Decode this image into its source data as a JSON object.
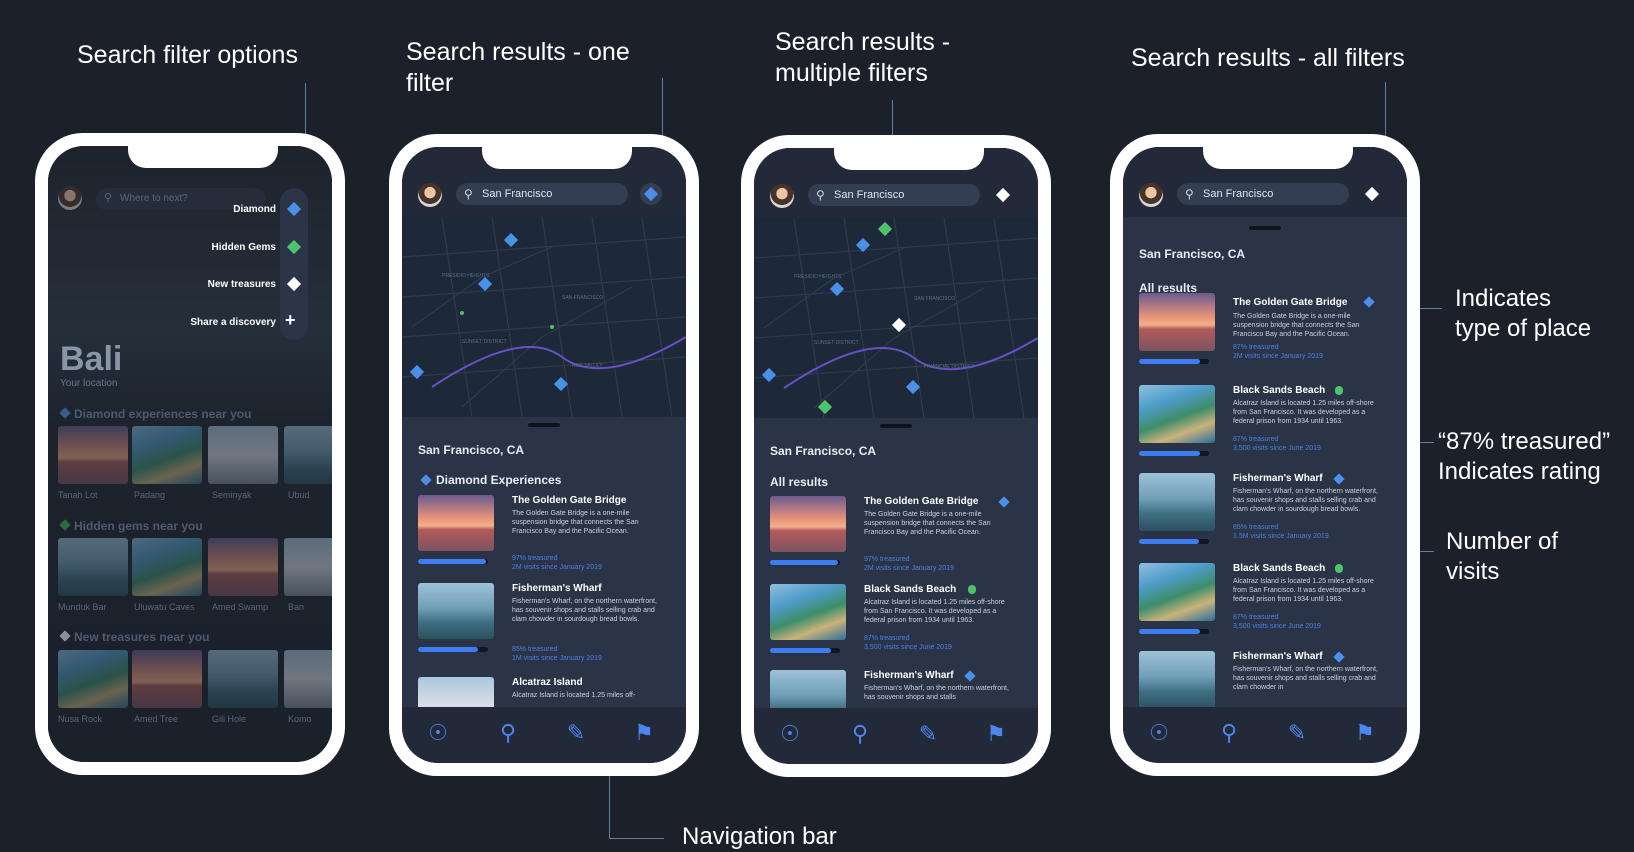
{
  "annotations": {
    "filter_options": "Search filter options",
    "one_filter": "Search results - one\nfilter",
    "multiple_filters": "Search results -\nmultiple filters",
    "all_filters": "Search results - all filters",
    "type_of_place": "Indicates\ntype of place",
    "rating": "“87% treasured”\nIndicates rating",
    "visits": "Number of\nvisits",
    "navigation_bar": "Navigation bar"
  },
  "phone1": {
    "search_placeholder": "Where to next?",
    "filters": [
      "Diamond",
      "Hidden Gems",
      "New treasures",
      "Share a discovery"
    ],
    "hero_title": "Bali",
    "hero_subtitle": "Your location",
    "sections": [
      {
        "title": "Diamond experiences near you",
        "items": [
          "Tanah Lot",
          "Padang",
          "Seminyak",
          "Ubud"
        ]
      },
      {
        "title": "Hidden gems near you",
        "items": [
          "Munduk Bar",
          "Uluwatu Caves",
          "Amed Swamp",
          "Ban"
        ]
      },
      {
        "title": "New treasures near you",
        "items": [
          "Nusa Rock",
          "Amed Tree",
          "Gili Hole",
          "Komo"
        ]
      }
    ]
  },
  "search": {
    "query": "San Francisco"
  },
  "location": "San Francisco,  CA",
  "phone2": {
    "section": "Diamond Experiences",
    "cards": [
      {
        "title": "The Golden Gate Bridge",
        "desc": "The Golden Gate Bridge is a one-mile suspension bridge that connects the San Francisco Bay and the Pacific Ocean.",
        "rating": "97% treasured",
        "visits": "2M visits since January 2019",
        "rating_value": 0.97
      },
      {
        "title": "Fisherman's Wharf",
        "desc": "Fisherman's Wharf, on the northern waterfront, has souvenir shops and stalls selling crab and clam chowder in sourdough bread bowls.",
        "rating": "85% treasured",
        "visits": "1M visits since January 2019",
        "rating_value": 0.85
      },
      {
        "title": "Alcatraz Island",
        "desc": "Alcatraz Island is located 1.25 miles off-",
        "rating": "",
        "visits": ""
      }
    ]
  },
  "phone3": {
    "section": "All results",
    "cards": [
      {
        "title": "The Golden Gate Bridge",
        "desc": "The Golden Gate Bridge is a one-mile suspension bridge that connects the San Francisco Bay and the Pacific Ocean.",
        "rating": "97% treasured",
        "visits": "2M visits since January 2019",
        "rating_value": 0.97
      },
      {
        "title": "Black Sands Beach",
        "desc": "Alcatraz Island is located 1.25 miles off-shore from San Francisco. It was developed as a federal prison from 1934 until 1963.",
        "rating": "87% treasured",
        "visits": "3,500 visits since June 2019",
        "rating_value": 0.87
      },
      {
        "title": "Fisherman's Wharf",
        "desc": "Fisherman's Wharf, on the northern waterfront, has souvenir shops and stalls",
        "rating": "",
        "visits": ""
      }
    ]
  },
  "phone4": {
    "section": "All results",
    "cards": [
      {
        "title": "The Golden Gate Bridge",
        "desc": "The Golden Gate Bridge is a one-mile suspension bridge that connects the San Francisco Bay and the Pacific Ocean.",
        "rating": "87% treasured",
        "visits": "2M visits since January 2019",
        "rating_value": 0.87
      },
      {
        "title": "Black Sands Beach",
        "desc": "Alcatraz Island is located 1.25 miles off-shore from San Francisco. It was developed as a federal prison from 1934 until 1963.",
        "rating": "87% treasured",
        "visits": "3,500 visits since June 2019",
        "rating_value": 0.87
      },
      {
        "title": "Fisherman's Wharf",
        "desc": "Fisherman's Wharf, on the northern waterfront, has souvenir shops and stalls selling crab and clam chowder in sourdough bread bowls.",
        "rating": "85% treasured",
        "visits": "1.5M visits since January 2019",
        "rating_value": 0.85
      },
      {
        "title": "Black Sands Beach",
        "desc": "Alcatraz Island is located 1.25 miles off-shore from San Francisco. It was developed as a federal prison from 1934 until 1963.",
        "rating": "87% treasured",
        "visits": "3,500 visits since June 2019",
        "rating_value": 0.87
      },
      {
        "title": "Fisherman's Wharf",
        "desc": "Fisherman's Wharf, on the northern waterfront, has souvenir shops and stalls selling crab and clam chowder in",
        "rating": "",
        "visits": ""
      }
    ]
  },
  "map_labels": [
    "SAN FRANCISCO",
    "PRESIDIO HEIGHTS",
    "SUNSET DISTRICT",
    "NOE VALLEY",
    "FINANCIAL DISTRICT"
  ],
  "nav_items": [
    "profile-icon",
    "search-icon",
    "pencil-icon",
    "bookmark-icon"
  ],
  "colors": {
    "diamond": "#4a8fe8",
    "hidden_gem": "#4cc46a",
    "new_treasure": "#ffffff",
    "accent": "#3e7cf2",
    "background": "#1b202a"
  }
}
